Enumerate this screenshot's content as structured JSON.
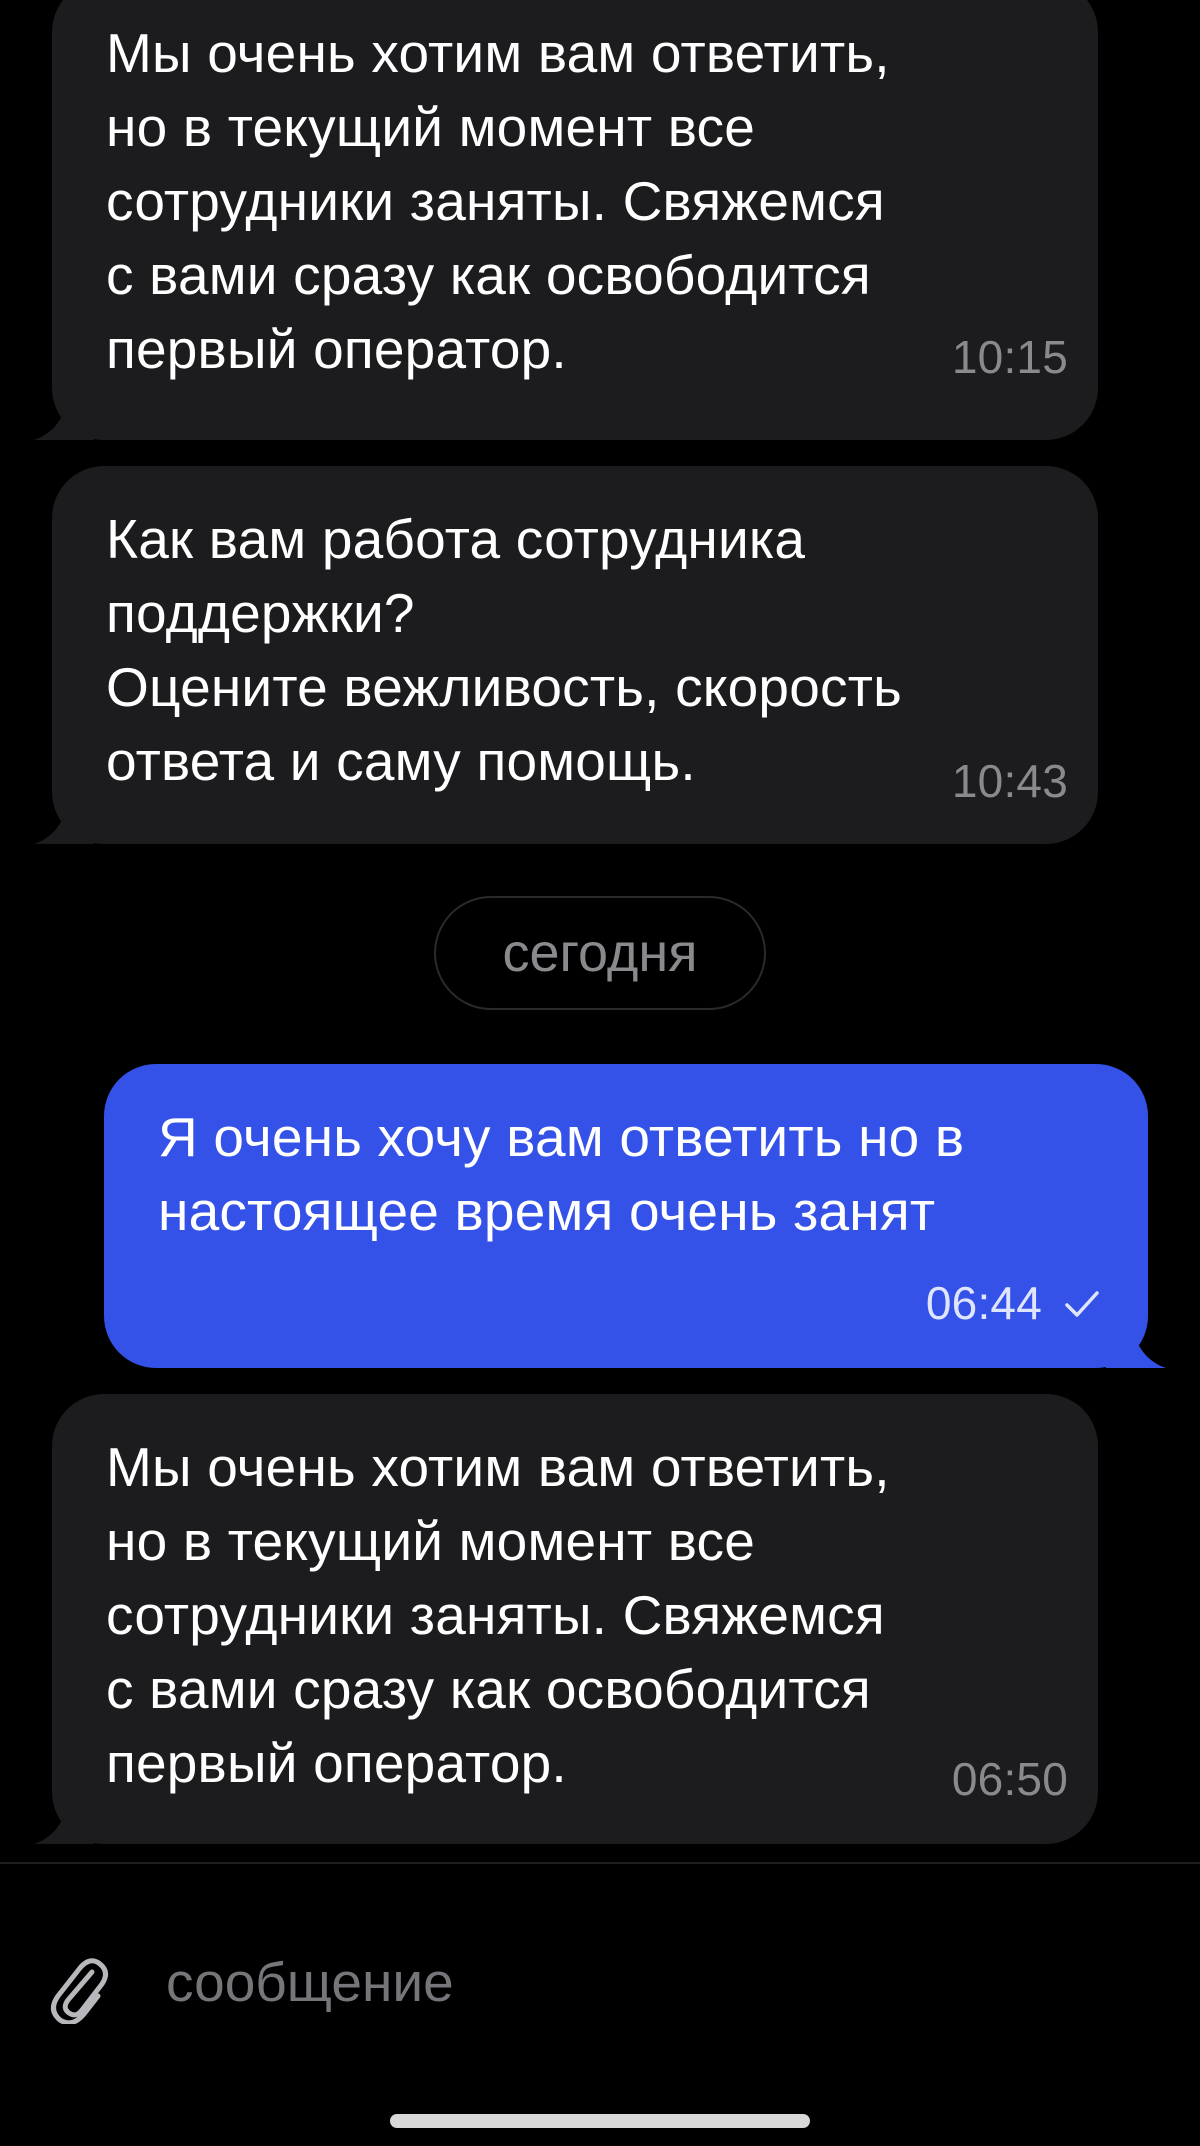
{
  "messages": [
    {
      "direction": "incoming",
      "text": "Мы очень хотим вам ответить,\nно в текущий момент все\nсотрудники заняты. Свяжемся\nс вами сразу как освободится\nпервый оператор.",
      "time": "10:15"
    },
    {
      "direction": "incoming",
      "text": "Как вам работа сотрудника\nподдержки?\nОцените вежливость, скорость\nответа и саму помощь.",
      "time": "10:43"
    },
    {
      "direction": "outgoing",
      "text": "Я очень хочу вам ответить но в\nнастоящее время очень занят",
      "time": "06:44",
      "status_icon": "checkmark-icon"
    },
    {
      "direction": "incoming",
      "text": "Мы очень хотим вам ответить,\nно в текущий момент все\nсотрудники заняты. Свяжемся\nс вами сразу как освободится\nпервый оператор.",
      "time": "06:50"
    }
  ],
  "date_separator": "сегодня",
  "composer": {
    "placeholder": "сообщение",
    "value": "",
    "attach_icon": "paperclip-icon"
  },
  "colors": {
    "background": "#000000",
    "incoming_bubble": "#1c1c1e",
    "outgoing_bubble": "#3452e8",
    "timestamp": "#8a8a8e"
  }
}
